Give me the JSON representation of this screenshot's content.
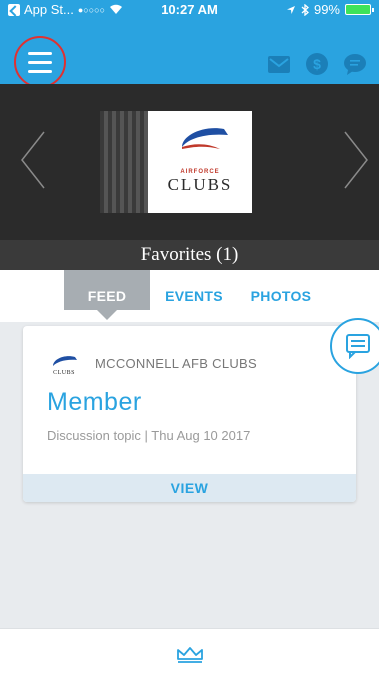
{
  "status_bar": {
    "back_app": "App St...",
    "signal": "●○○○○",
    "time": "10:27 AM",
    "battery_percent": "99%"
  },
  "navbar": {
    "icons": [
      "menu-icon",
      "mail-icon",
      "dollar-icon",
      "chat-icon"
    ]
  },
  "hero": {
    "logo_top": "AIRFORCE",
    "logo_text": "CLUBS",
    "caption": "Favorites (1)"
  },
  "tabs": [
    {
      "label": "FEED",
      "active": true
    },
    {
      "label": "EVENTS",
      "active": false
    },
    {
      "label": "PHOTOS",
      "active": false
    }
  ],
  "feed": {
    "items": [
      {
        "club": "MCCONNELL AFB CLUBS",
        "title": "Member",
        "subtitle": "Discussion topic | Thu Aug 10 2017",
        "action": "VIEW"
      }
    ]
  },
  "bottom_bar": {
    "icon": "crown-icon"
  },
  "colors": {
    "accent": "#2aa3e0",
    "highlight_ring": "#e03131",
    "tab_active": "#a7adb2"
  }
}
